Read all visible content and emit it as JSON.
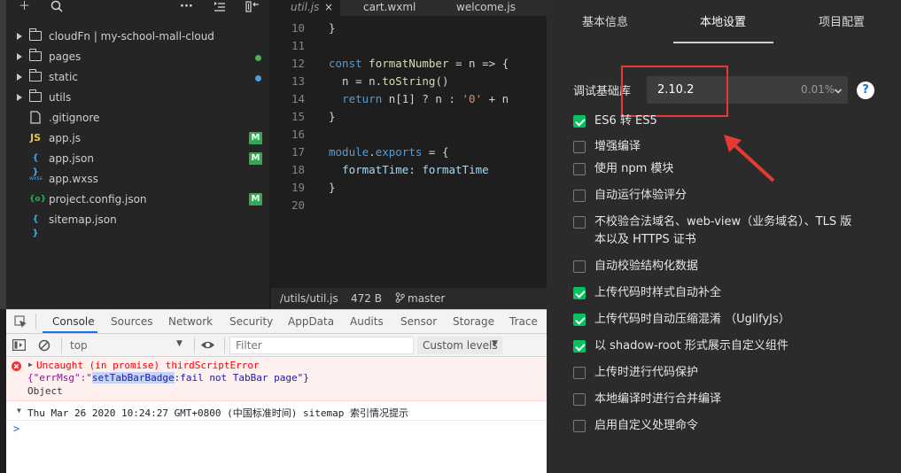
{
  "explorer": {
    "items": [
      {
        "label": "cloudFn | my-school-mall-cloud",
        "kind": "folder-cloud",
        "expandable": true
      },
      {
        "label": "pages",
        "kind": "folder",
        "expandable": true,
        "status": "green-dot"
      },
      {
        "label": "static",
        "kind": "folder",
        "expandable": true,
        "status": "blue-dot"
      },
      {
        "label": "utils",
        "kind": "folder",
        "expandable": true
      },
      {
        "label": ".gitignore",
        "kind": "file"
      },
      {
        "label": "app.js",
        "kind": "js",
        "icon_text": "JS",
        "badge": "M"
      },
      {
        "label": "app.json",
        "kind": "json",
        "icon_text": "{ }",
        "badge": "M"
      },
      {
        "label": "app.wxss",
        "kind": "wxss",
        "icon_text": "wxss"
      },
      {
        "label": "project.config.json",
        "kind": "config",
        "icon_text": "{o}",
        "badge": "M"
      },
      {
        "label": "sitemap.json",
        "kind": "json",
        "icon_text": "{ }"
      }
    ]
  },
  "editor": {
    "tabs": [
      {
        "label": "util.js",
        "active": true
      },
      {
        "label": "cart.wxml",
        "active": false
      },
      {
        "label": "welcome.js",
        "active": false
      }
    ],
    "tab_close": "×",
    "lines": [
      {
        "n": "10",
        "code": "}"
      },
      {
        "n": "11",
        "code": ""
      },
      {
        "n": "12",
        "code": "const formatNumber = n => {"
      },
      {
        "n": "13",
        "code": "  n = n.toString()"
      },
      {
        "n": "14",
        "code": "  return n[1] ? n : '0' + n"
      },
      {
        "n": "15",
        "code": "}"
      },
      {
        "n": "16",
        "code": ""
      },
      {
        "n": "17",
        "code": "module.exports = {"
      },
      {
        "n": "18",
        "code": "  formatTime: formatTime"
      },
      {
        "n": "19",
        "code": "}"
      },
      {
        "n": "20",
        "code": ""
      }
    ],
    "status": {
      "path": "/utils/util.js",
      "size": "472 B",
      "branch": "master"
    }
  },
  "devtools": {
    "tabs": [
      "Console",
      "Sources",
      "Network",
      "Security",
      "AppData",
      "Audits",
      "Sensor",
      "Storage",
      "Trace"
    ],
    "active_tab": "Console",
    "context": "top",
    "filter_placeholder": "Filter",
    "levels": "Custom levels",
    "error": {
      "line1": "Uncaught (in promise) thirdScriptError",
      "line2_prefix": "{\"errMsg\":\"",
      "line2_highlight": "setTabBarBadge",
      "line2_suffix": ":fail not TabBar page\"}",
      "line3": "Object"
    },
    "log": "Thu Mar 26 2020 10:24:27 GMT+0800 (中国标准时间) sitemap 索引情况提示",
    "prompt": ">"
  },
  "settings": {
    "tabs": [
      "基本信息",
      "本地设置",
      "项目配置"
    ],
    "active_tab": "本地设置",
    "lib_label": "调试基础库",
    "lib_version": "2.10.2",
    "lib_usage": "0.01%",
    "help": "?",
    "options": [
      {
        "label": "ES6 转 ES5",
        "checked": true
      },
      {
        "label": "增强编译",
        "checked": false
      },
      {
        "label": "使用 npm 模块",
        "checked": false
      },
      {
        "label": "自动运行体验评分",
        "checked": false
      },
      {
        "label": "不校验合法域名、web-view（业务域名）、TLS 版",
        "label2": "本以及 HTTPS 证书",
        "checked": false
      },
      {
        "label": "自动校验结构化数据",
        "checked": false
      },
      {
        "label": "上传代码时样式自动补全",
        "checked": true
      },
      {
        "label": "上传代码时自动压缩混淆 （UglifyJs）",
        "checked": true
      },
      {
        "label": "以 shadow-root 形式展示自定义组件",
        "checked": true
      },
      {
        "label": "上传时进行代码保护",
        "checked": false
      },
      {
        "label": "本地编译时进行合并编译",
        "checked": false
      },
      {
        "label": "启用自定义处理命令",
        "checked": false
      }
    ]
  },
  "colors": {
    "accent_green": "#07c160",
    "annotation_red": "#e53935",
    "badge_green": "#34a853",
    "link_blue": "#1a73e8"
  }
}
